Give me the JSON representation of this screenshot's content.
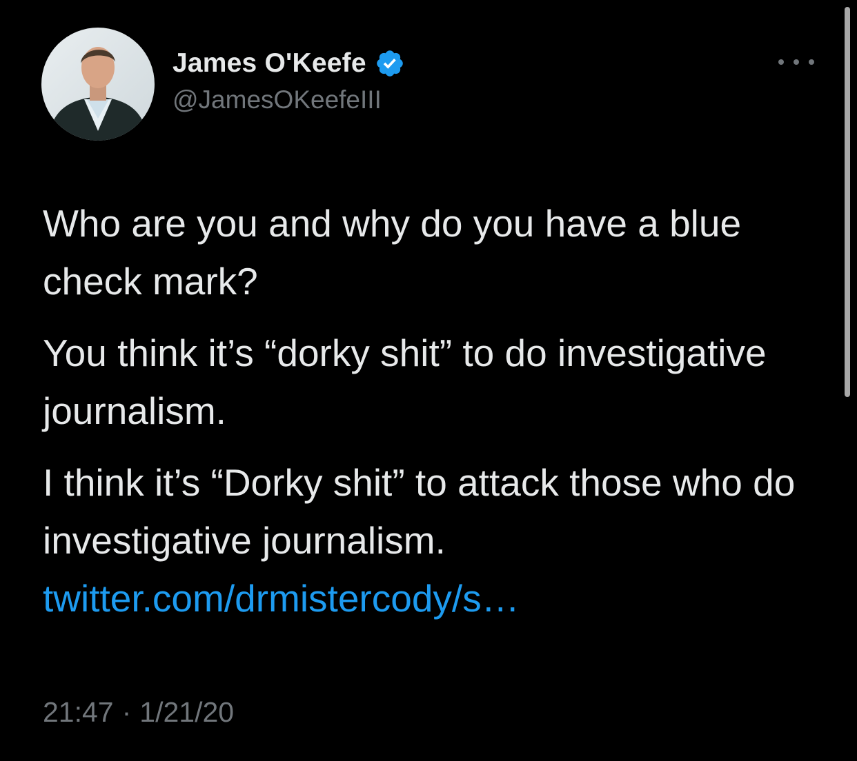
{
  "author": {
    "display_name": "James O'Keefe",
    "handle": "@JamesOKeefeIII",
    "verified": true,
    "avatar_icon": "profile-photo"
  },
  "more_icon": "ellipsis-icon",
  "tweet": {
    "paragraph_1": "Who are you and why do you have a blue check mark?",
    "paragraph_2": "You think it’s “dorky shit” to do investigative journalism.",
    "paragraph_3": "I think it’s “Dorky shit” to attack those who do investigative journalism.",
    "link_text": "twitter.com/drmistercody/s…"
  },
  "meta": {
    "time": "21:47",
    "separator": "·",
    "date": "1/21/20"
  },
  "colors": {
    "background": "#000000",
    "primary_text": "#e7e9ea",
    "secondary_text": "#71767b",
    "link": "#1d9bf0",
    "verified_badge": "#1d9bf0"
  }
}
